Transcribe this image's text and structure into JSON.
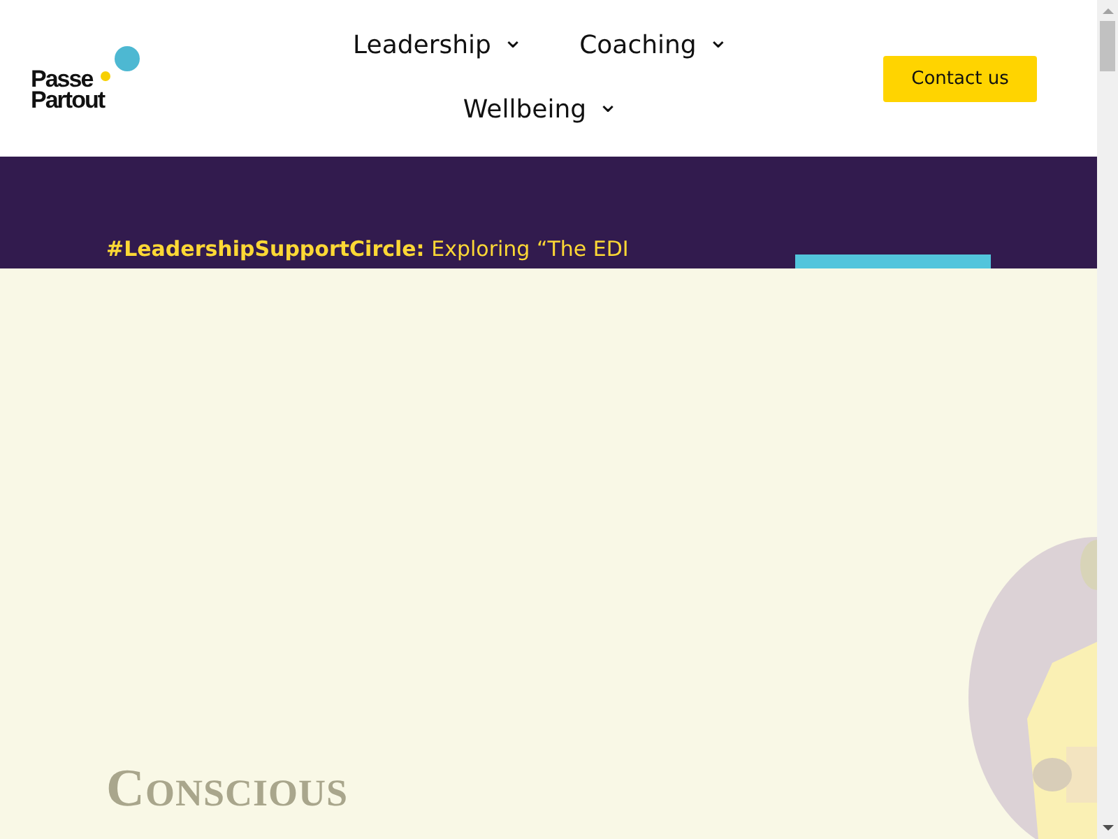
{
  "header": {
    "logo": {
      "line_1": "Passe",
      "line_2": "Partout"
    },
    "nav": [
      {
        "label": "Leadership",
        "caret": "⌄"
      },
      {
        "label": "Coaching",
        "caret": "⌄"
      },
      {
        "label": "Wellbeing",
        "caret": "⌄"
      }
    ],
    "cta": "Contact us"
  },
  "promo": {
    "tag": "#LeadershipSupportCircle:",
    "text": "Exploring “The EDI"
  },
  "hero": {
    "heading": "Conscious"
  }
}
